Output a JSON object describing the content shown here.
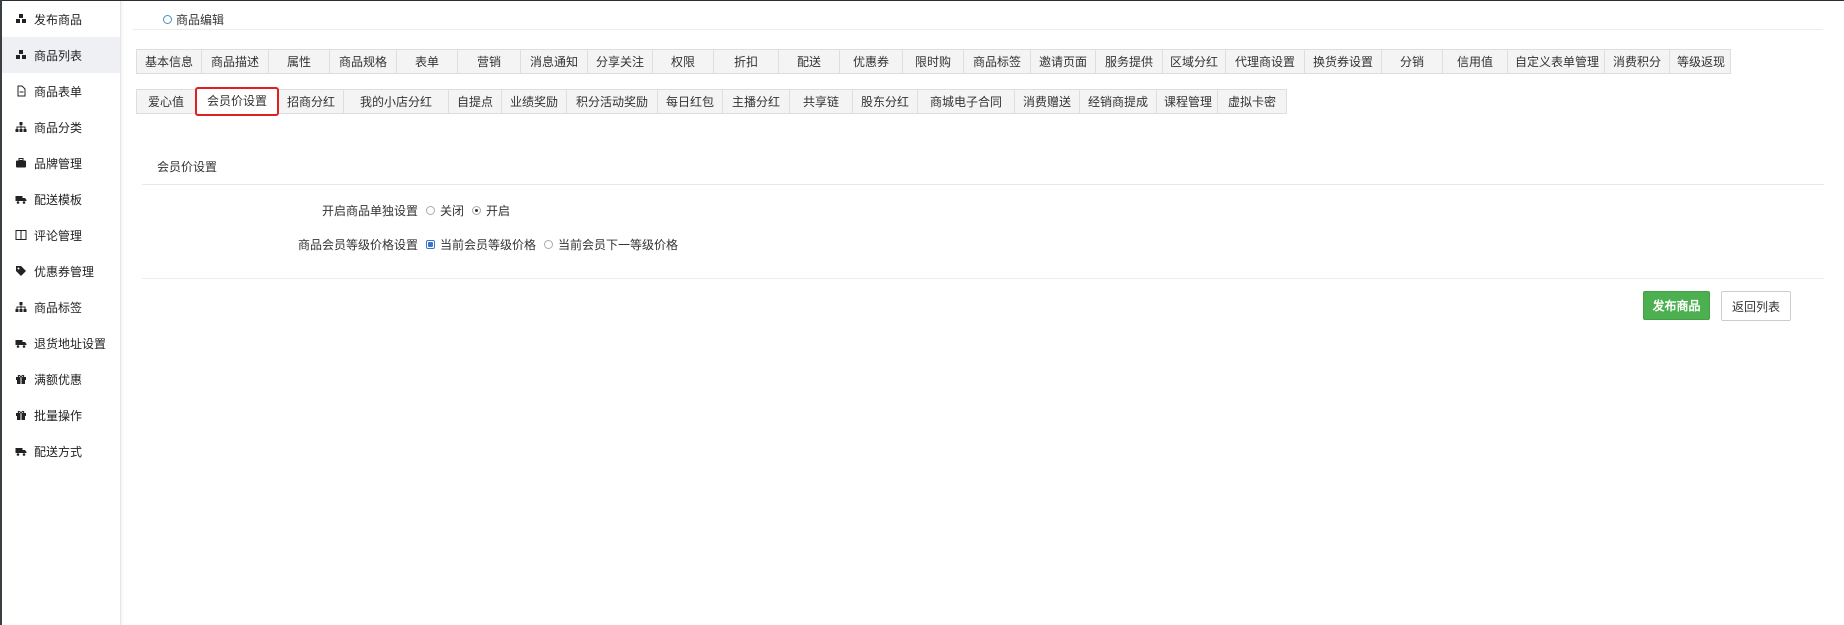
{
  "sidebar": {
    "items": [
      {
        "label": "发布商品",
        "icon": "cubes-icon",
        "active": false
      },
      {
        "label": "商品列表",
        "icon": "cubes-icon",
        "active": true
      },
      {
        "label": "商品表单",
        "icon": "file-icon",
        "active": false
      },
      {
        "label": "商品分类",
        "icon": "sitemap-icon",
        "active": false
      },
      {
        "label": "品牌管理",
        "icon": "briefcase-icon",
        "active": false
      },
      {
        "label": "配送模板",
        "icon": "truck-icon",
        "active": false
      },
      {
        "label": "评论管理",
        "icon": "columns-icon",
        "active": false
      },
      {
        "label": "优惠券管理",
        "icon": "tags-icon",
        "active": false
      },
      {
        "label": "商品标签",
        "icon": "sitemap-icon",
        "active": false
      },
      {
        "label": "退货地址设置",
        "icon": "truck-icon",
        "active": false
      },
      {
        "label": "满额优惠",
        "icon": "gift-icon",
        "active": false
      },
      {
        "label": "批量操作",
        "icon": "gift-icon",
        "active": false
      },
      {
        "label": "配送方式",
        "icon": "truck-icon",
        "active": false
      }
    ]
  },
  "breadcrumb": {
    "label": "商品编辑"
  },
  "tabs_row1": [
    "基本信息",
    "商品描述",
    "属性",
    "商品规格",
    "表单",
    "营销",
    "消息通知",
    "分享关注",
    "权限",
    "折扣",
    "配送",
    "优惠券",
    "限时购",
    "商品标签",
    "邀请页面",
    "服务提供",
    "区域分红",
    "代理商设置",
    "换货券设置",
    "分销",
    "信用值",
    "自定义表单管理",
    "消费积分",
    "等级返现"
  ],
  "tabs_row2": [
    "爱心值",
    "会员价设置",
    "招商分红",
    "我的小店分红",
    "自提点",
    "业绩奖励",
    "积分活动奖励",
    "每日红包",
    "主播分红",
    "共享链",
    "股东分红",
    "商城电子合同",
    "消费赠送",
    "经销商提成",
    "课程管理",
    "虚拟卡密"
  ],
  "active_tab": "会员价设置",
  "section": {
    "title": "会员价设置"
  },
  "form": {
    "row1": {
      "label": "开启商品单独设置",
      "options": [
        "关闭",
        "开启"
      ],
      "selected": "开启"
    },
    "row2": {
      "label": "商品会员等级价格设置",
      "options": [
        "当前会员等级价格",
        "当前会员下一等级价格"
      ],
      "selected": "当前会员等级价格"
    }
  },
  "buttons": {
    "publish": "发布商品",
    "back": "返回列表"
  },
  "colors": {
    "primary": "#4caf50",
    "active_border": "#e02020"
  }
}
